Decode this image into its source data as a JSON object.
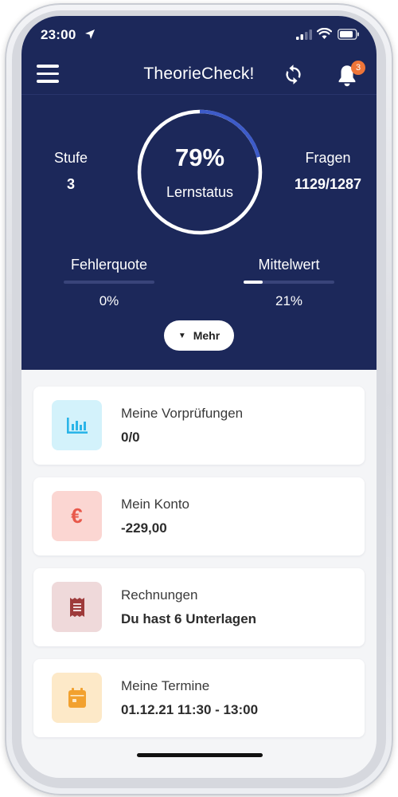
{
  "status_bar": {
    "time": "23:00"
  },
  "header": {
    "title": "TheorieCheck!",
    "notification_count": "3"
  },
  "stats": {
    "level_label": "Stufe",
    "level_value": "3",
    "progress_percent": "79%",
    "progress_label": "Lernstatus",
    "progress_fraction": 0.79,
    "questions_label": "Fragen",
    "questions_value": "1129/1287"
  },
  "bars": {
    "error_label": "Fehlerquote",
    "error_value": "0%",
    "error_fraction": 0.0,
    "mean_label": "Mittelwert",
    "mean_value": "21%",
    "mean_fraction": 0.21
  },
  "more_button": {
    "label": "Mehr"
  },
  "cards": [
    {
      "title": "Meine Vorprüfungen",
      "value": "0/0",
      "icon": "bar-chart-icon",
      "icon_color": "#2bb5e8",
      "icon_bg": "#d3f2fb"
    },
    {
      "title": "Mein Konto",
      "value": "-229,00",
      "icon": "euro-icon",
      "icon_glyph": "€",
      "icon_color": "#e8584a",
      "icon_bg": "#fbd6d2"
    },
    {
      "title": "Rechnungen",
      "value": "Du hast 6 Unterlagen",
      "icon": "receipt-icon",
      "icon_color": "#9e3a3a",
      "icon_bg": "#efd9da"
    },
    {
      "title": "Meine Termine",
      "value": "01.12.21 11:30 - 13:00",
      "icon": "calendar-icon",
      "icon_color": "#f2a12f",
      "icon_bg": "#fde9c8"
    }
  ],
  "colors": {
    "header_bg": "#1c285a",
    "ring_accent": "#3d5bc9",
    "badge": "#ee7538"
  }
}
